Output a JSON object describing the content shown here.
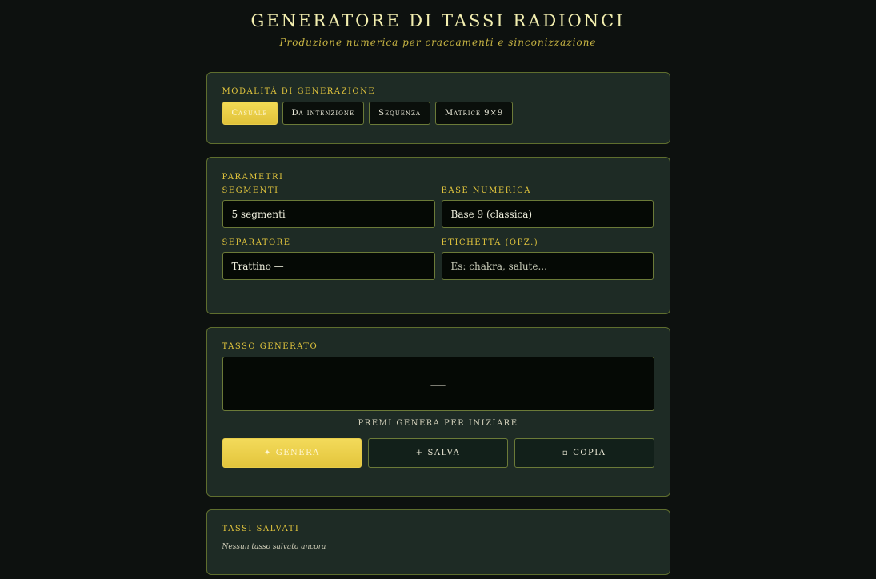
{
  "header": {
    "title": "Generatore di Tassi Radionci",
    "subtitle": "Produzione numerica per craccamenti e sinconizzazione"
  },
  "modes": {
    "label": "Modalità di generazione",
    "items": [
      {
        "label": "Casuale",
        "active": true
      },
      {
        "label": "Da intenzione",
        "active": false
      },
      {
        "label": "Sequenza",
        "active": false
      },
      {
        "label": "Matrice 9×9",
        "active": false
      }
    ]
  },
  "params": {
    "label": "Parametri",
    "segments": {
      "label": "Segmenti",
      "value": "5 segmenti"
    },
    "base": {
      "label": "Base numerica",
      "value": "Base 9 (classica)"
    },
    "separator": {
      "label": "Separatore",
      "value": "Trattino —"
    },
    "tag": {
      "label": "Etichetta (opz.)",
      "placeholder": "Es: chakra, salute..."
    }
  },
  "result": {
    "label": "Tasso generato",
    "value": "—",
    "hint": "Premi GENERA per iniziare",
    "generate": {
      "icon": "✦",
      "label": "Genera"
    },
    "save": {
      "icon": "+",
      "label": "Salva"
    },
    "copy": {
      "icon": "▫",
      "label": "Copia"
    }
  },
  "saved": {
    "label": "Tassi salvati",
    "empty": "Nessun tasso salvato ancora"
  },
  "colors": {
    "accent": "#e2c53d",
    "background": "#0d110f",
    "card": "#1e2b25",
    "border": "#5f6e2e"
  }
}
